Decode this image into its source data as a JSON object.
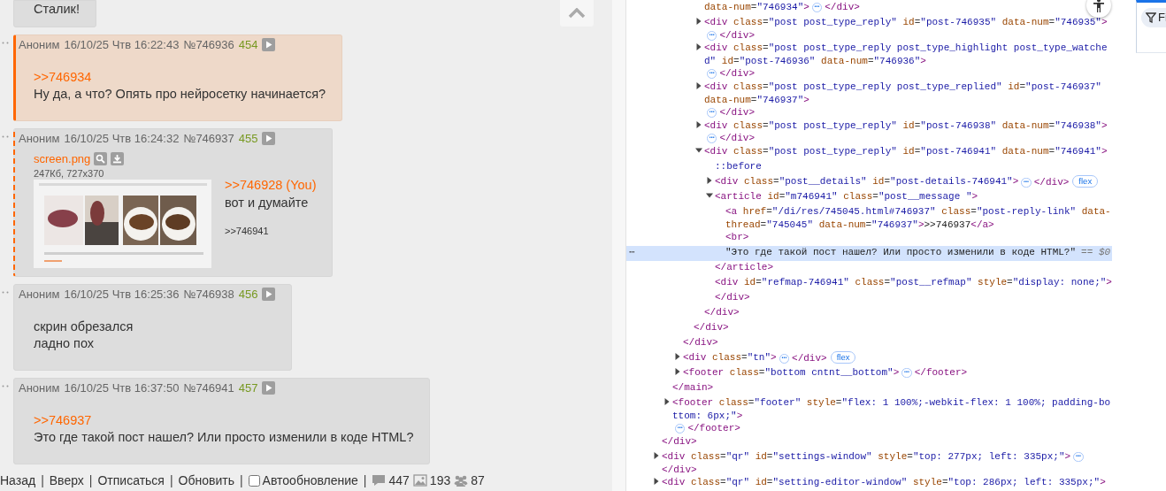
{
  "page": {
    "posts": [
      {
        "highlighted": false,
        "replied": false,
        "message": [
          {
            "kind": "text",
            "text": "Сталик!"
          }
        ]
      },
      {
        "author": "Аноним",
        "date": "16/10/25 Чтв 16:22:43",
        "number": "№746936",
        "count": "454",
        "highlighted": true,
        "replied": false,
        "message": [
          {
            "kind": "reply",
            "text": ">>746934"
          },
          {
            "kind": "text",
            "text": "Ну да, а что? Опять про нейросетку начинается?"
          }
        ]
      },
      {
        "author": "Аноним",
        "date": "16/10/25 Чтв 16:24:32",
        "number": "№746937",
        "count": "455",
        "highlighted": false,
        "replied": true,
        "file": {
          "name": "screen.png",
          "info": "247Кб, 727x370",
          "kind": "picture"
        },
        "message": [
          {
            "kind": "reply",
            "text": ">>746928 (You)"
          },
          {
            "kind": "text",
            "text": "вот и думайте"
          }
        ],
        "refs": [
          ">>746941"
        ]
      },
      {
        "author": "Аноним",
        "date": "16/10/25 Чтв 16:25:36",
        "number": "№746938",
        "count": "456",
        "highlighted": false,
        "replied": false,
        "message": [
          {
            "kind": "text",
            "text": "скрин обрезался"
          },
          {
            "kind": "text",
            "text": "ладно пох"
          }
        ]
      },
      {
        "author": "Аноним",
        "date": "16/10/25 Чтв 16:37:50",
        "number": "№746941",
        "count": "457",
        "highlighted": false,
        "replied": false,
        "message": [
          {
            "kind": "reply",
            "text": ">>746937"
          },
          {
            "kind": "text",
            "text": "Это где такой пост нашел? Или просто изменили в коде HTML?"
          }
        ]
      }
    ],
    "footer": {
      "links": [
        "Назад",
        "Вверх",
        "Отписаться",
        "Обновить"
      ],
      "separator": "|",
      "autoupdate": {
        "label": "Автообновление",
        "checked": false
      },
      "stats": [
        {
          "kind": "posts",
          "value": "447"
        },
        {
          "kind": "images",
          "value": "193"
        },
        {
          "kind": "users",
          "value": "87"
        }
      ]
    }
  },
  "devtools": {
    "selected_gutter": "⋯",
    "selected_suffix": "== $0",
    "tree": [
      {
        "close": "</div>",
        "children": [
          {
            "close": "</main>",
            "children": [
              {
                "close": "</div>",
                "children": [
                  {
                    "close": "</div>",
                    "children": [
                      {
                        "kind": "fragment",
                        "selected": false,
                        "open": "data-num=\"746934\">",
                        "ellipsis": "⋯",
                        "close": "</div>"
                      },
                      {
                        "kind": "element",
                        "selected": false,
                        "expanded": false,
                        "open": "<div class=\"post post_type_reply\" id=\"post-746935\" data-num=\"746935\">",
                        "ellipsis": "⋯",
                        "close": "</div>"
                      },
                      {
                        "kind": "element",
                        "selected": false,
                        "expanded": false,
                        "open": "<div class=\"post post_type_reply post_type_highlight post_type_watched\" id=\"post-746936\" data-num=\"746936\">",
                        "ellipsis": "⋯",
                        "close": "</div>"
                      },
                      {
                        "kind": "element",
                        "selected": false,
                        "expanded": false,
                        "open": "<div class=\"post post_type_reply post_type_replied\" id=\"post-746937\" data-num=\"746937\">",
                        "ellipsis": "⋯",
                        "close": "</div>"
                      },
                      {
                        "kind": "element",
                        "selected": false,
                        "expanded": false,
                        "open": "<div class=\"post post_type_reply\" id=\"post-746938\" data-num=\"746938\">",
                        "ellipsis": "⋯",
                        "close": "</div>"
                      },
                      {
                        "kind": "element",
                        "selected": false,
                        "expanded": true,
                        "open": "<div class=\"post post_type_reply\" id=\"post-746941\" data-num=\"746941\">",
                        "close": "</div>",
                        "children": [
                          {
                            "kind": "pseudo",
                            "selected": false,
                            "open": "::before"
                          },
                          {
                            "kind": "element",
                            "selected": false,
                            "expanded": false,
                            "open": "<div class=\"post__details\" id=\"post-details-746941\">",
                            "ellipsis": "⋯",
                            "close": "</div>",
                            "badge": "flex"
                          },
                          {
                            "kind": "element",
                            "selected": false,
                            "expanded": true,
                            "open": "<article id=\"m746941\" class=\"post__message \">",
                            "close": "</article>",
                            "children": [
                              {
                                "kind": "element",
                                "selected": false,
                                "open": "<a href=\"/di/res/745045.html#746937\" class=\"post-reply-link\" data-thread=\"745045\" data-num=\"746937\">>>746937</a>"
                              },
                              {
                                "kind": "element",
                                "selected": false,
                                "open": "<br>"
                              },
                              {
                                "kind": "text",
                                "selected": true,
                                "open": "\"Это где такой пост нашел? Или просто изменили в коде HTML?\""
                              }
                            ]
                          },
                          {
                            "kind": "element",
                            "selected": false,
                            "open": "<div id=\"refmap-746941\" class=\"post__refmap\" style=\"display: none;\">",
                            "close": "</div>"
                          }
                        ]
                      }
                    ]
                  }
                ]
              },
              {
                "kind": "element",
                "selected": false,
                "expanded": false,
                "open": "<div class=\"tn\">",
                "ellipsis": "⋯",
                "close": "</div>",
                "badge": "flex"
              },
              {
                "kind": "element",
                "selected": false,
                "expanded": false,
                "open": "<footer class=\"bottom cntnt__bottom\">",
                "ellipsis": "⋯",
                "close": "</footer>"
              }
            ]
          },
          {
            "kind": "element",
            "selected": false,
            "expanded": false,
            "open": "<footer class=\"footer\" style=\"flex: 1 100%;-webkit-flex: 1 100%; padding-bottom: 6px;\">",
            "ellipsis": "⋯",
            "close": "</footer>"
          }
        ]
      },
      {
        "kind": "element",
        "selected": false,
        "expanded": false,
        "open": "<div class=\"qr\" id=\"settings-window\" style=\"top: 277px; left: 335px;\">",
        "ellipsis": "⋯",
        "close": "</div>"
      },
      {
        "kind": "element",
        "selected": false,
        "expanded": false,
        "open": "<div class=\"qr\" id=\"setting-editor-window\" style=\"top: 286px; left: 335px;\">"
      }
    ]
  },
  "side_panel": {
    "filter_label": "Fi"
  }
}
